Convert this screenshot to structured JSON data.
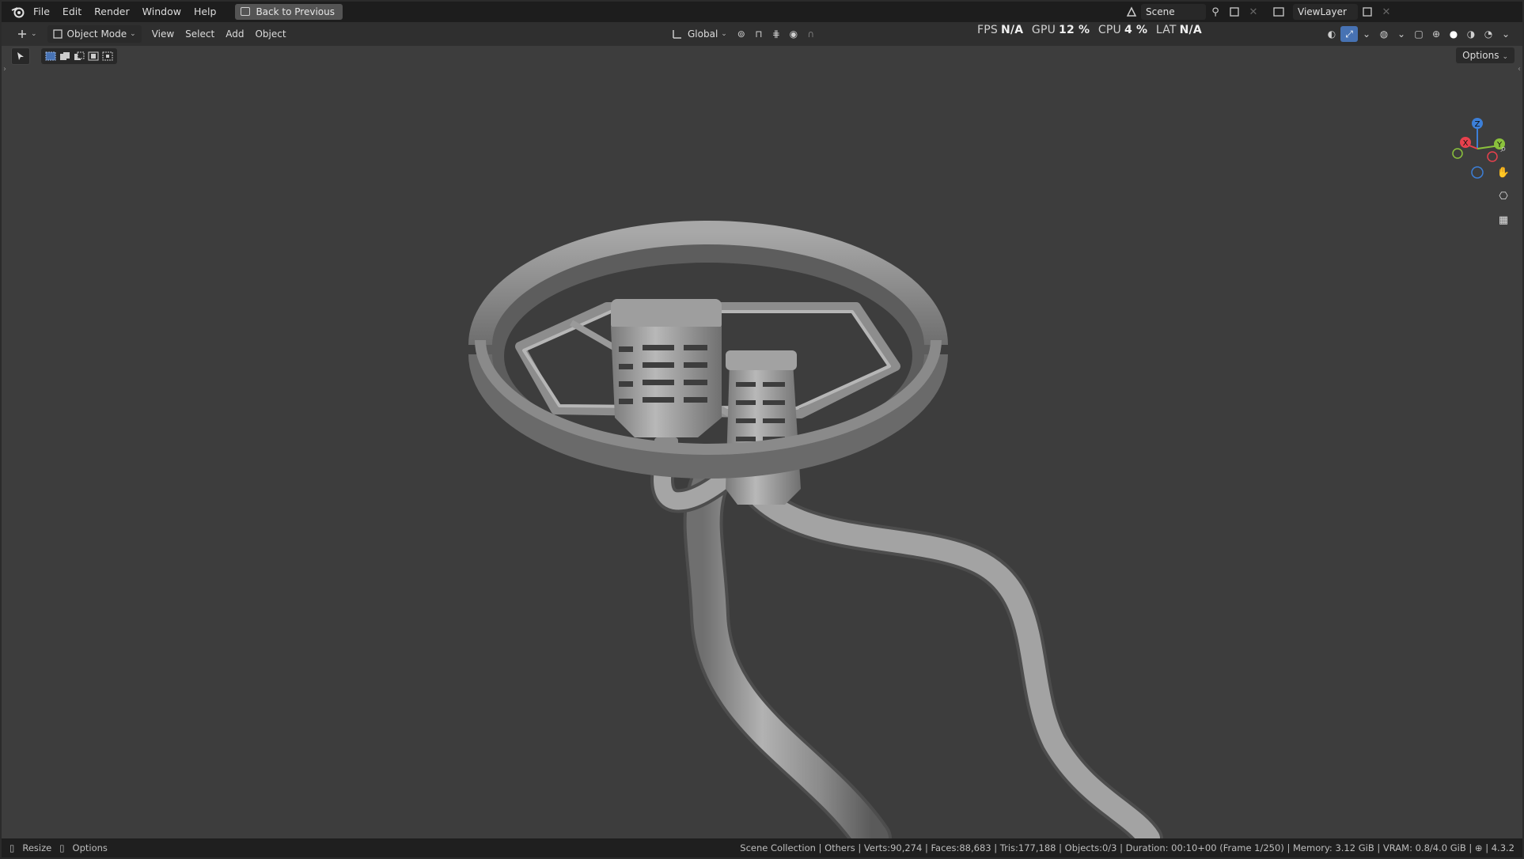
{
  "menu": {
    "items": [
      "File",
      "Edit",
      "Render",
      "Window",
      "Help"
    ],
    "back_button": "Back to Previous"
  },
  "scene": {
    "name": "Scene",
    "view_layer": "ViewLayer"
  },
  "header": {
    "mode": "Object Mode",
    "menus": [
      "View",
      "Select",
      "Add",
      "Object"
    ],
    "transform_orientation": "Global"
  },
  "stats": {
    "fps_label": "FPS",
    "fps_value": "N/A",
    "gpu_label": "GPU",
    "gpu_value": "12 %",
    "cpu_label": "CPU",
    "cpu_value": "4 %",
    "lat_label": "LAT",
    "lat_value": "N/A"
  },
  "viewport": {
    "options_label": "Options"
  },
  "gizmo": {
    "x": "X",
    "y": "Y",
    "z": "Z"
  },
  "statusbar": {
    "resize": "Resize",
    "options": "Options",
    "info": "Scene Collection | Others | Verts:90,274 | Faces:88,683 | Tris:177,188 | Objects:0/3 | Duration: 00:10+00 (Frame 1/250) | Memory: 3.12 GiB | VRAM: 0.8/4.0 GiB",
    "version": "4.3.2"
  },
  "colors": {
    "accent": "#4772b3",
    "axis_x": "#e8414d",
    "axis_y": "#8bc23c",
    "axis_z": "#3c7fd8"
  }
}
